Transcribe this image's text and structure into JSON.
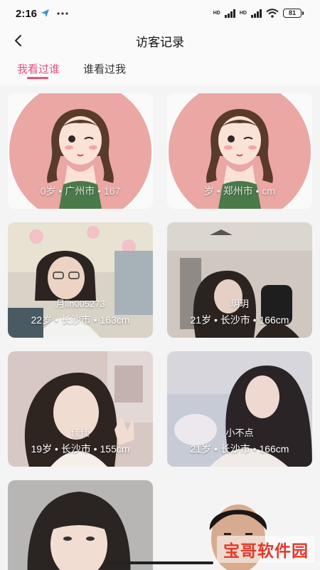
{
  "status_bar": {
    "time": "2:16",
    "battery": "81",
    "network_1": "HD",
    "network_2": "HD"
  },
  "header": {
    "title": "访客记录"
  },
  "tabs": [
    {
      "label": "我看过谁",
      "active": true
    },
    {
      "label": "谁看过我",
      "active": false
    }
  ],
  "cards": [
    {
      "name": "",
      "info": "0岁 • 广州市 • 167",
      "avatar": "illustrated-girl"
    },
    {
      "name": "",
      "info": "岁 • 郑州市 • cm",
      "avatar": "illustrated-girl"
    },
    {
      "name": "月lin005273",
      "info": "22岁 • 长沙市 • 163cm",
      "avatar": "photo"
    },
    {
      "name": "玥玥",
      "info": "21岁 • 长沙市 • 166cm",
      "avatar": "photo"
    },
    {
      "name": "佳佳",
      "info": "19岁 • 长沙市 • 155cm",
      "avatar": "photo"
    },
    {
      "name": "小不点",
      "info": "21岁 • 长沙市 • 166cm",
      "avatar": "photo"
    },
    {
      "name": "",
      "info": "",
      "avatar": "photo"
    },
    {
      "name": "",
      "info": "",
      "avatar": "photo"
    }
  ],
  "watermark": {
    "text": "宝哥软件园"
  },
  "colors": {
    "accent": "#e8507a",
    "background": "#f4f4f4"
  }
}
